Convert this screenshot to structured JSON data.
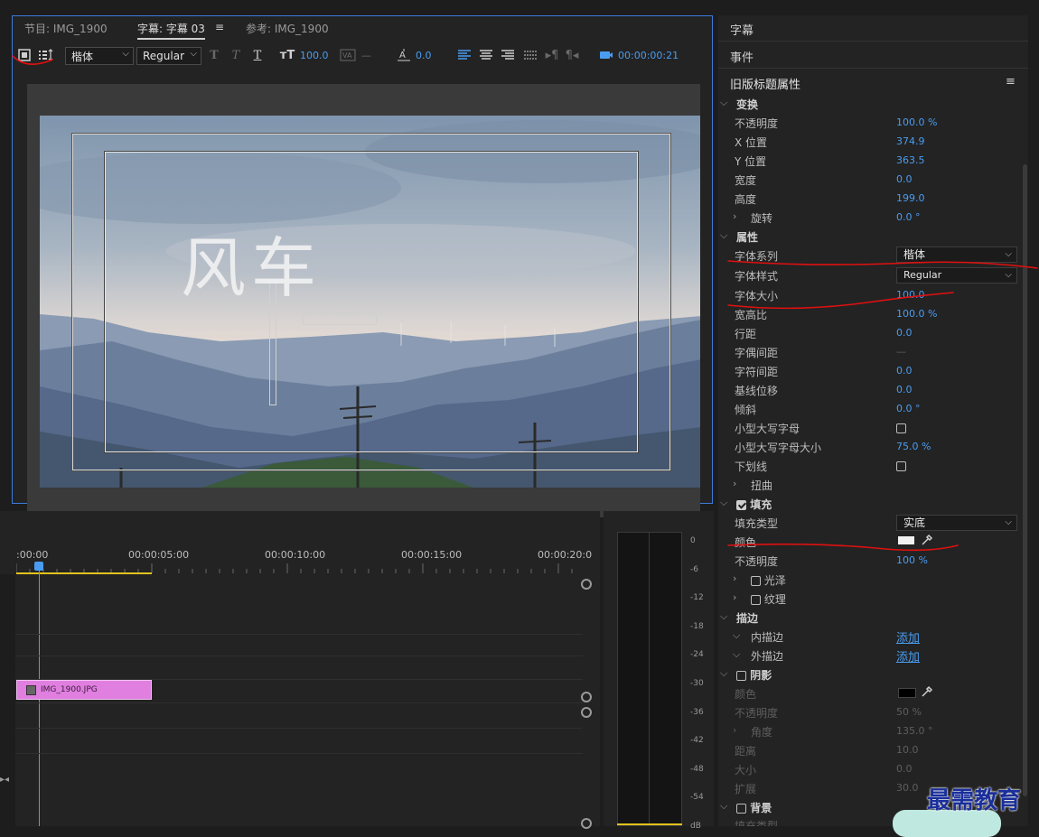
{
  "title_panel": {
    "tabs": [
      {
        "label": "节目: IMG_1900"
      },
      {
        "label": "字幕: 字幕 03"
      },
      {
        "label": "参考: IMG_1900"
      }
    ],
    "menu_icon": "≡",
    "toolbar": {
      "font_family": "楷体",
      "font_style": "Regular",
      "font_size": "100.0",
      "tracking": "—",
      "baseline": "0.0",
      "timecode": "00:00:00:21"
    },
    "caption_text": "风车"
  },
  "properties": {
    "panels": [
      "字幕",
      "事件"
    ],
    "legacy_title": "旧版标题属性",
    "menu_icon": "≡",
    "transform": {
      "label": "变换",
      "opacity": {
        "label": "不透明度",
        "value": "100.0 %"
      },
      "x": {
        "label": "X 位置",
        "value": "374.9"
      },
      "y": {
        "label": "Y 位置",
        "value": "363.5"
      },
      "width": {
        "label": "宽度",
        "value": "0.0"
      },
      "height": {
        "label": "高度",
        "value": "199.0"
      },
      "rotation": {
        "label": "旋转",
        "value": "0.0 °"
      }
    },
    "attributes": {
      "label": "属性",
      "font_family": {
        "label": "字体系列",
        "value": "楷体"
      },
      "font_style": {
        "label": "字体样式",
        "value": "Regular"
      },
      "font_size": {
        "label": "字体大小",
        "value": "100.0"
      },
      "aspect": {
        "label": "宽高比",
        "value": "100.0 %"
      },
      "leading": {
        "label": "行距",
        "value": "0.0"
      },
      "kerning": {
        "label": "字偶间距",
        "value": "—"
      },
      "tracking": {
        "label": "字符间距",
        "value": "0.0"
      },
      "baseline": {
        "label": "基线位移",
        "value": "0.0"
      },
      "slant": {
        "label": "倾斜",
        "value": "0.0 °"
      },
      "small_caps": {
        "label": "小型大写字母"
      },
      "small_caps_size": {
        "label": "小型大写字母大小",
        "value": "75.0 %"
      },
      "underline": {
        "label": "下划线"
      },
      "distort": {
        "label": "扭曲"
      }
    },
    "fill": {
      "label": "填充",
      "type": {
        "label": "填充类型",
        "value": "实底"
      },
      "color": {
        "label": "颜色",
        "hex": "#f2f2f2"
      },
      "opacity": {
        "label": "不透明度",
        "value": "100 %"
      },
      "sheen": {
        "label": "光泽"
      },
      "texture": {
        "label": "纹理"
      }
    },
    "stroke": {
      "label": "描边",
      "inner": {
        "label": "内描边",
        "action": "添加"
      },
      "outer": {
        "label": "外描边",
        "action": "添加"
      }
    },
    "shadow": {
      "label": "阴影",
      "color": {
        "label": "颜色",
        "hex": "#000000"
      },
      "opacity": {
        "label": "不透明度",
        "value": "50 %"
      },
      "angle": {
        "label": "角度",
        "value": "135.0 °"
      },
      "distance": {
        "label": "距离",
        "value": "10.0"
      },
      "size": {
        "label": "大小",
        "value": "0.0"
      },
      "spread": {
        "label": "扩展",
        "value": "30.0"
      }
    },
    "background": {
      "label": "背景",
      "fill_type": "填充类型"
    }
  },
  "timeline": {
    "timecodes": [
      ":00:00",
      "00:00:05:00",
      "00:00:10:00",
      "00:00:15:00",
      "00:00:20:0"
    ],
    "clip_name": "IMG_1900.JPG",
    "clip_color": "#e07fe0"
  },
  "meter": {
    "scale": [
      "0",
      "-6",
      "-12",
      "-18",
      "-24",
      "-30",
      "-36",
      "-42",
      "-48",
      "-54",
      "dB"
    ]
  },
  "watermark": "最需教育"
}
